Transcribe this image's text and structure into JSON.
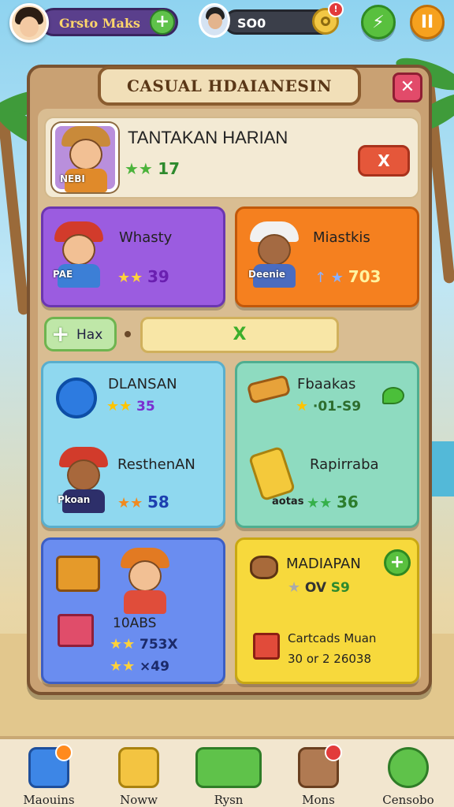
{
  "topbar": {
    "player_name": "Grsto Maks",
    "add_label": "+",
    "coins": "SO0",
    "notif": "!",
    "play_label": "⚡",
    "pause_label": "II"
  },
  "panel": {
    "title": "CASUAL HDAIANESIN",
    "close_label": "✕"
  },
  "header": {
    "title": "TANTAKAN HARIAN",
    "portrait_tag": "NEBI",
    "stars": "★★",
    "count": "17",
    "button_label": "X"
  },
  "quests": [
    {
      "name": "Whasty",
      "tag": "PAE",
      "stars": "★★",
      "value": "39"
    },
    {
      "name": "Miastkis",
      "tag": "Deenie",
      "stars": "↑ ★",
      "value": "703"
    },
    {
      "name": "DLANSAN",
      "stars": "★★",
      "value": "35"
    },
    {
      "name": "Fbaakas",
      "stars": "★",
      "value": "·01-S9"
    },
    {
      "name": "ResthenAN",
      "tag": "Pkoan",
      "stars": "★★",
      "value": "58"
    },
    {
      "name": "Rapirraba",
      "tag": "aotas",
      "stars": "★★",
      "value": "36"
    },
    {
      "name": "10ABS",
      "line1_stars": "★★",
      "line1_value": "753X",
      "line2_stars": "★★",
      "line2_value": "×49"
    },
    {
      "name": "MADIAPAN",
      "stars": "★",
      "value_a": "OV",
      "value_b": "S9",
      "sub_title": "Cartcads Muan",
      "sub_value": "30 or 2 26038"
    }
  ],
  "filter": {
    "plus": "+",
    "label": "Hax",
    "field": "X"
  },
  "bottom_nav": [
    {
      "label": "Maouins"
    },
    {
      "label": "Noww"
    },
    {
      "label": "Rysn"
    },
    {
      "label": "Mons"
    },
    {
      "label": "Censobo"
    }
  ],
  "colors": {
    "purple": "#9b5ce0",
    "orange": "#f5801f",
    "cyan": "#8fd8ef",
    "mint": "#8edbc0",
    "blue": "#6a8df0",
    "yellow": "#f7d93c",
    "panel": "#c9a173"
  }
}
